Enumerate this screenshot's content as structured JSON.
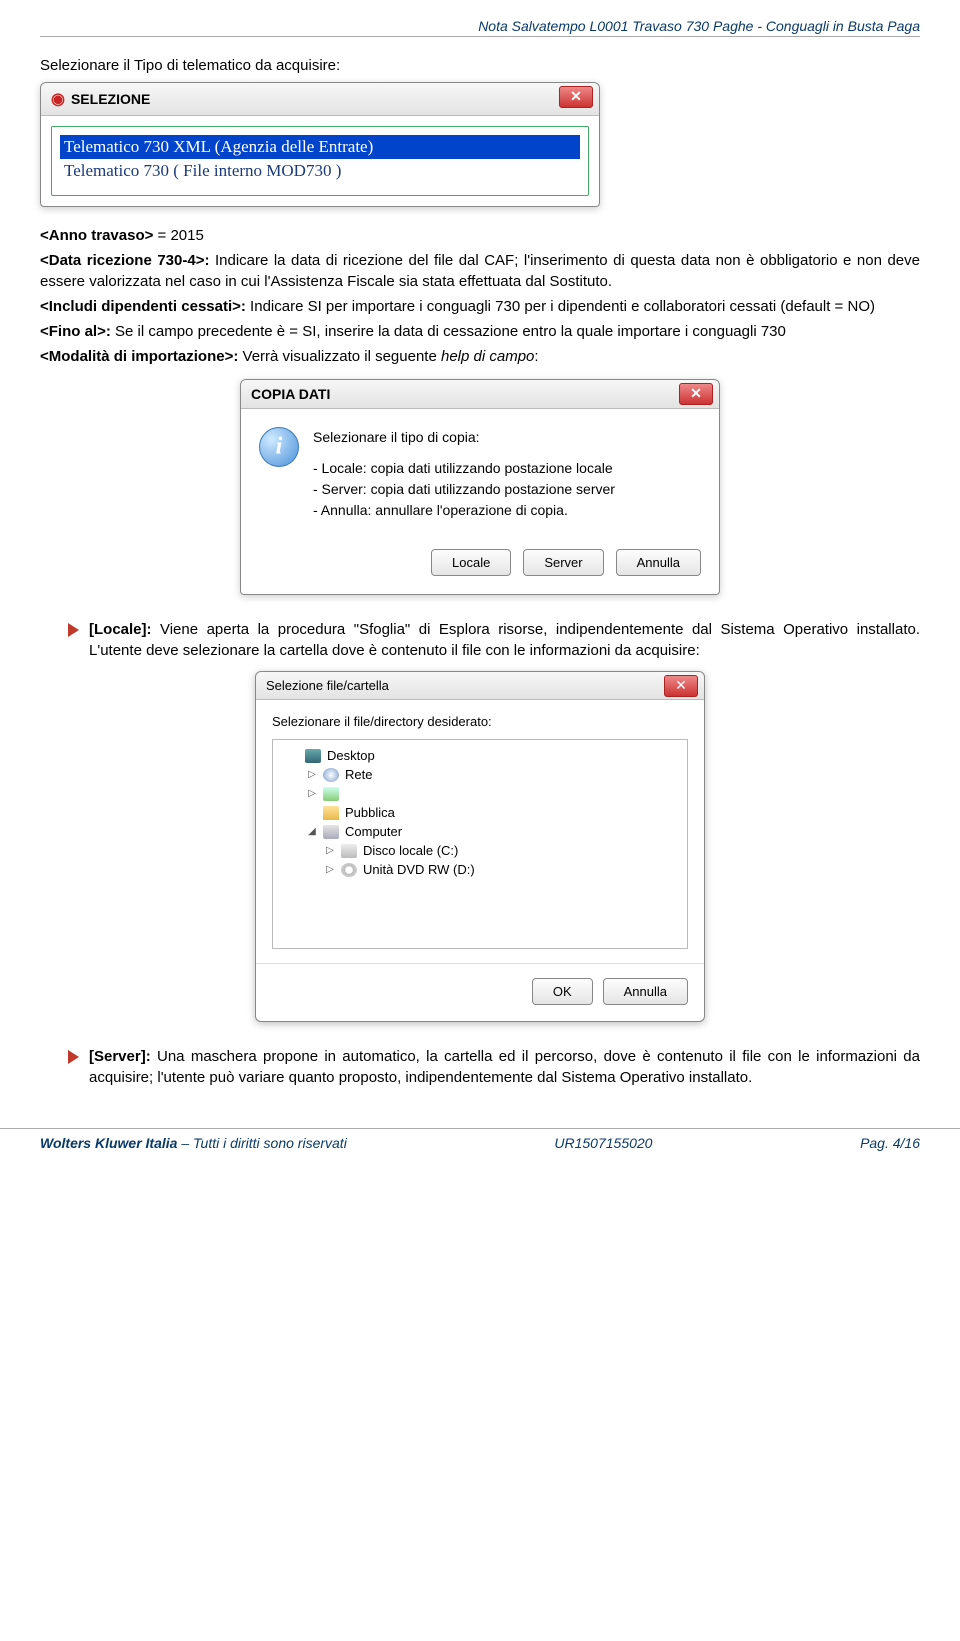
{
  "header": {
    "text": "Nota Salvatempo  L0001 Travaso 730 Paghe - Conguagli in Busta Paga"
  },
  "intro": "Selezionare il Tipo di telematico da acquisire:",
  "selezione_dialog": {
    "title": "SELEZIONE",
    "options": [
      {
        "text": "Telematico 730 XML (Agenzia delle Entrate)",
        "selected": true
      },
      {
        "text": "Telematico 730     ( File interno MOD730 )",
        "selected": false
      }
    ]
  },
  "params": {
    "anno": {
      "label": "<Anno travaso>",
      "body": " = 2015"
    },
    "data_ric": {
      "label": "<Data ricezione 730-4>:",
      "body": " Indicare la data di ricezione del file dal CAF; l'inserimento di questa data non è obbligatorio e non deve essere valorizzata nel caso in cui l'Assistenza Fiscale sia stata effettuata dal Sostituto."
    },
    "includi": {
      "label": "<Includi dipendenti cessati>:",
      "body": " Indicare SI per importare i conguagli 730 per i dipendenti e collaboratori cessati (default = NO)"
    },
    "fino_al": {
      "label": "<Fino al>:",
      "body": " Se il campo precedente è = SI, inserire la data di cessazione entro la quale importare i conguagli 730"
    },
    "modalita": {
      "label": "<Modalità di importazione>:",
      "body_lead": " Verrà visualizzato il seguente ",
      "body_ital": "help di campo",
      "body_tail": ":"
    }
  },
  "copia_dialog": {
    "title": "COPIA DATI",
    "heading": "Selezionare il tipo di copia:",
    "line1": "- Locale: copia dati utilizzando postazione locale",
    "line2": "- Server: copia dati utilizzando postazione server",
    "line3": "- Annulla: annullare l'operazione di copia.",
    "buttons": {
      "locale": "Locale",
      "server": "Server",
      "annulla": "Annulla"
    }
  },
  "bullet_locale": {
    "lead": "[Locale]:",
    "body": " Viene aperta la procedura \"Sfoglia\" di Esplora risorse, indipendentemente dal Sistema Operativo installato. L'utente deve selezionare la cartella dove è contenuto il file con le informazioni da acquisire:"
  },
  "file_dialog": {
    "title": "Selezione file/cartella",
    "label": "Selezionare il file/directory desiderato:",
    "tree": {
      "desktop": "Desktop",
      "rete": "Rete",
      "pubblica": "Pubblica",
      "computer": "Computer",
      "disco": "Disco locale (C:)",
      "dvd": "Unità DVD RW (D:)"
    },
    "buttons": {
      "ok": "OK",
      "annulla": "Annulla"
    }
  },
  "bullet_server": {
    "lead": "[Server]:",
    "body": " Una maschera propone in automatico, la cartella ed il percorso, dove è contenuto il file con le informazioni da acquisire; l'utente può variare quanto proposto, indipendentemente dal Sistema Operativo installato."
  },
  "footer": {
    "company": "Wolters Kluwer Italia",
    "rights": " – Tutti i diritti sono riservati",
    "code": "UR1507155020",
    "page": "Pag.  4/16"
  }
}
